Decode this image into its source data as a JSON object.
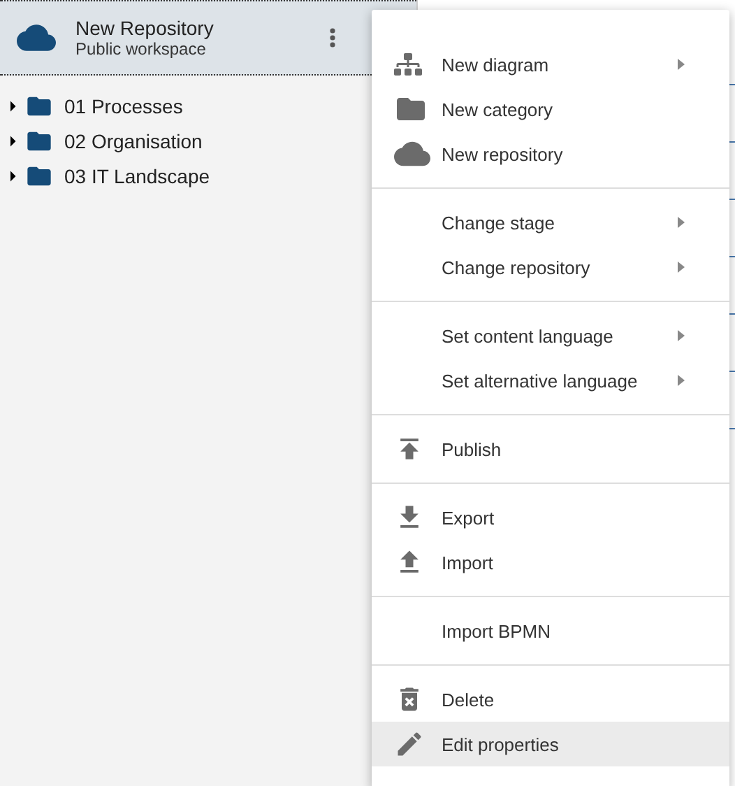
{
  "repository": {
    "name": "New Repository",
    "workspace": "Public workspace"
  },
  "tree": [
    {
      "label": "01 Processes",
      "expanded": false
    },
    {
      "label": "02 Organisation",
      "expanded": false
    },
    {
      "label": "03 IT Landscape",
      "expanded": false
    }
  ],
  "context_menu": {
    "groups": [
      {
        "items": [
          {
            "label": "New diagram",
            "kind": "sitemap",
            "submenu": true,
            "highlighted": false
          },
          {
            "label": "New category",
            "kind": "folder",
            "submenu": false,
            "highlighted": false
          },
          {
            "label": "New repository",
            "kind": "cloud",
            "submenu": false,
            "highlighted": false
          }
        ]
      },
      {
        "items": [
          {
            "label": "Change stage",
            "submenu": true,
            "highlighted": false
          },
          {
            "label": "Change repository",
            "submenu": true,
            "highlighted": false
          }
        ]
      },
      {
        "items": [
          {
            "label": "Set content language",
            "submenu": true,
            "highlighted": false
          },
          {
            "label": "Set alternative language",
            "submenu": true,
            "highlighted": false
          }
        ]
      },
      {
        "items": [
          {
            "label": "Publish",
            "kind": "publish",
            "submenu": false,
            "highlighted": false
          }
        ]
      },
      {
        "items": [
          {
            "label": "Export",
            "kind": "download",
            "submenu": false,
            "highlighted": false
          },
          {
            "label": "Import",
            "kind": "upload",
            "submenu": false,
            "highlighted": false
          }
        ]
      },
      {
        "items": [
          {
            "label": "Import BPMN",
            "submenu": false,
            "highlighted": false
          }
        ]
      },
      {
        "items": [
          {
            "label": "Delete",
            "kind": "delete",
            "submenu": false,
            "highlighted": false
          },
          {
            "label": "Edit properties",
            "kind": "edit",
            "submenu": false,
            "highlighted": true
          }
        ]
      }
    ]
  }
}
